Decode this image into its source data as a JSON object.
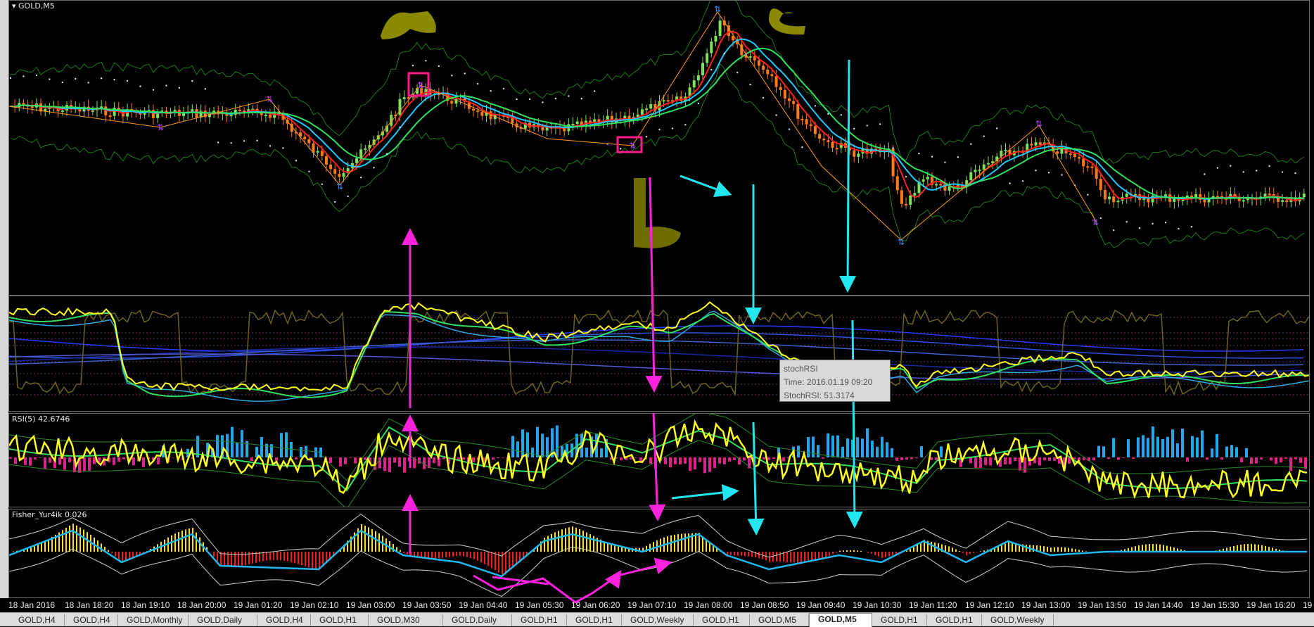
{
  "window": {
    "symbol_title": "GOLD,M5"
  },
  "panels": {
    "rsi_title": "RSI(5) 42.6746",
    "fisher_title": "Fisher_Yur4ik 0.026"
  },
  "tooltip": {
    "line1": "stochRSI",
    "line2": "Time: 2016.01.19 09:20",
    "line3": "StochRSI: 51.3174"
  },
  "time_axis": [
    "18 Jan 2016",
    "18 Jan 18:20",
    "18 Jan 19:10",
    "18 Jan 20:00",
    "19 Jan 01:20",
    "19 Jan 02:10",
    "19 Jan 03:00",
    "19 Jan 03:50",
    "19 Jan 04:40",
    "19 Jan 05:30",
    "19 Jan 06:20",
    "19 Jan 07:10",
    "19 Jan 08:00",
    "19 Jan 08:50",
    "19 Jan 09:40",
    "19 Jan 10:30",
    "19 Jan 11:20",
    "19 Jan 12:10",
    "19 Jan 13:00",
    "19 Jan 13:50",
    "19 Jan 14:40",
    "19 Jan 15:30",
    "19 Jan 16:20",
    "19"
  ],
  "tabs": [
    {
      "label": "GOLD,H4",
      "active": false
    },
    {
      "label": "GOLD,H4",
      "active": false
    },
    {
      "label": "GOLD,Monthly",
      "active": false
    },
    {
      "label": "GOLD,Daily",
      "active": false
    },
    {
      "label": "GOLD,H4",
      "active": false
    },
    {
      "label": "GOLD,H1",
      "active": false
    },
    {
      "label": "GOLD,M30",
      "active": false
    },
    {
      "label": "GOLD,Daily",
      "active": false
    },
    {
      "label": "GOLD,H1",
      "active": false
    },
    {
      "label": "GOLD,H1",
      "active": false
    },
    {
      "label": "GOLD,Weekly",
      "active": false
    },
    {
      "label": "GOLD,H1",
      "active": false
    },
    {
      "label": "GOLD,M5",
      "active": false
    },
    {
      "label": "GOLD,M5",
      "active": true
    },
    {
      "label": "GOLD,H1",
      "active": false
    },
    {
      "label": "GOLD,H1",
      "active": false
    },
    {
      "label": "GOLD,Weekly",
      "active": false
    }
  ],
  "colors": {
    "background": "#000000",
    "bull_candle": "#7fe05a",
    "bear_candle": "#ff7a1a",
    "ma_red": "#ff2020",
    "ma_cyan": "#20c8ff",
    "ma_green": "#30e060",
    "annotation_magenta": "#ff22dd",
    "annotation_cyan": "#22e6f0",
    "annotation_olive": "#8a8a00",
    "rsi_yellow": "#ffff20",
    "histogram_red": "#ff1a1a",
    "histogram_yellow": "#ffe020"
  }
}
